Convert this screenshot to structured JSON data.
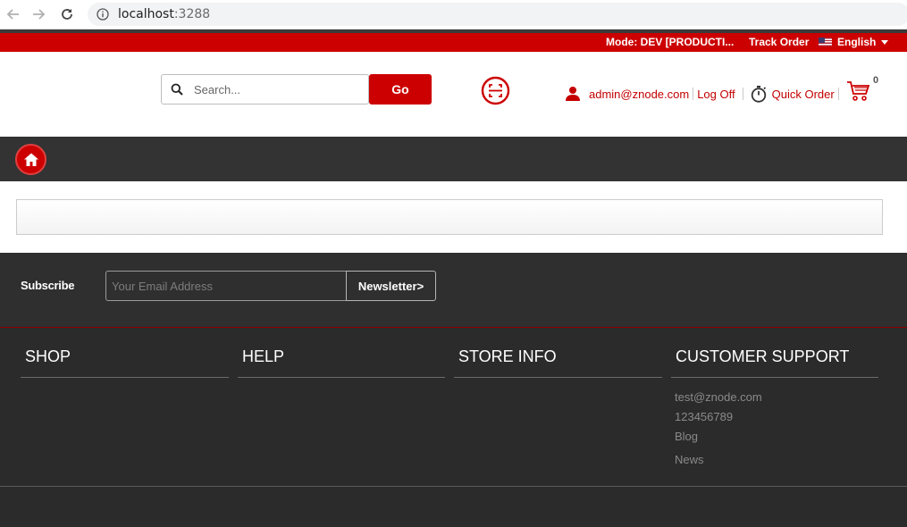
{
  "browser": {
    "url_host": "localhost",
    "url_port": ":3288"
  },
  "topbar": {
    "mode": "Mode: DEV [PRODUCTI...",
    "track_order": "Track Order",
    "language": "English"
  },
  "header": {
    "search_placeholder": "Search...",
    "go_label": "Go",
    "user_email": "admin@znode.com",
    "logoff_label": "Log Off",
    "quick_order_label": "Quick Order",
    "cart_count": "0"
  },
  "subscribe": {
    "label": "Subscribe",
    "email_placeholder": "Your Email Address",
    "newsletter_label": "Newsletter>"
  },
  "footer": {
    "columns": [
      {
        "title": "SHOP"
      },
      {
        "title": "HELP"
      },
      {
        "title": "STORE INFO"
      },
      {
        "title": "CUSTOMER SUPPORT"
      }
    ],
    "support_links": [
      "test@znode.com",
      "123456789",
      "Blog",
      "News"
    ]
  },
  "colors": {
    "brand_red": "#cc0000",
    "nav_dark": "#333333",
    "footer_dark": "#2b2b2b"
  },
  "icons": {
    "back": "arrow-left-icon",
    "forward": "arrow-right-icon",
    "reload": "reload-icon",
    "info": "info-icon",
    "search": "search-icon",
    "scan": "barcode-scan-icon",
    "user": "user-icon",
    "timer": "stopwatch-icon",
    "cart": "shopping-cart-icon",
    "home": "home-icon",
    "flag": "us-flag-icon"
  }
}
